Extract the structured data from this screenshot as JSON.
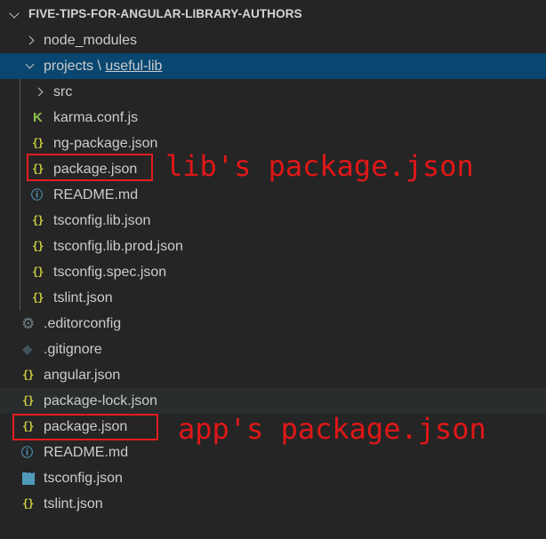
{
  "explorer": {
    "section_title": "FIVE-TIPS-FOR-ANGULAR-LIBRARY-AUTHORS",
    "items": [
      {
        "label": "node_modules"
      },
      {
        "label": "projects",
        "separator": "\\",
        "sublabel": "useful-lib"
      },
      {
        "label": "src"
      },
      {
        "label": "karma.conf.js"
      },
      {
        "label": "ng-package.json"
      },
      {
        "label": "package.json"
      },
      {
        "label": "README.md"
      },
      {
        "label": "tsconfig.lib.json"
      },
      {
        "label": "tsconfig.lib.prod.json"
      },
      {
        "label": "tsconfig.spec.json"
      },
      {
        "label": "tslint.json"
      },
      {
        "label": ".editorconfig"
      },
      {
        "label": ".gitignore"
      },
      {
        "label": "angular.json"
      },
      {
        "label": "package-lock.json"
      },
      {
        "label": "package.json"
      },
      {
        "label": "README.md"
      },
      {
        "label": "tsconfig.json"
      },
      {
        "label": "tslint.json"
      }
    ]
  },
  "icons": {
    "json": "{}",
    "info": "ⓘ",
    "karma": "K",
    "gear": "⚙",
    "git": "◆",
    "ts": "TS"
  },
  "annotations": {
    "lib": "lib's package.json",
    "app": "app's package.json"
  },
  "colors": {
    "background": "#252526",
    "selected": "#094771",
    "json_icon": "#cbcb41",
    "annotation": "#e01717"
  }
}
